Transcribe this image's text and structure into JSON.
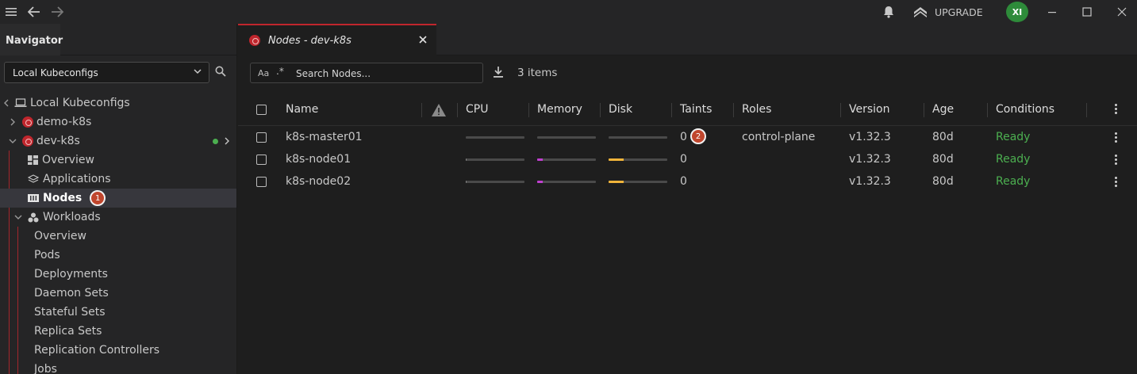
{
  "titlebar": {
    "upgrade_label": "UPGRADE",
    "avatar_initials": "XI"
  },
  "navigator": {
    "tab_label": "Navigator",
    "context_select_value": "Local Kubeconfigs",
    "tree": {
      "root_label": "Local Kubeconfigs",
      "clusters": [
        {
          "label": "demo-k8s"
        },
        {
          "label": "dev-k8s"
        }
      ],
      "dev_items": {
        "overview": "Overview",
        "applications": "Applications",
        "nodes": "Nodes",
        "nodes_badge": "1",
        "workloads": "Workloads"
      },
      "workload_items": [
        "Overview",
        "Pods",
        "Deployments",
        "Daemon Sets",
        "Stateful Sets",
        "Replica Sets",
        "Replication Controllers",
        "Jobs"
      ]
    }
  },
  "main": {
    "tab_title": "Nodes - dev-k8s",
    "search": {
      "aa_label": "Aa",
      "regex_label": ".*",
      "placeholder": "Search Nodes..."
    },
    "items_count": "3 items",
    "taints_badge": "2",
    "columns": {
      "name": "Name",
      "cpu": "CPU",
      "memory": "Memory",
      "disk": "Disk",
      "taints": "Taints",
      "roles": "Roles",
      "version": "Version",
      "age": "Age",
      "conditions": "Conditions"
    },
    "rows": [
      {
        "name": "k8s-master01",
        "cpu": 0.0,
        "memory": 0.0,
        "disk": 0.0,
        "taints": "0",
        "roles": "control-plane",
        "version": "v1.32.3",
        "age": "80d",
        "conditions": "Ready"
      },
      {
        "name": "k8s-node01",
        "cpu": 0.02,
        "memory": 0.1,
        "disk": 0.25,
        "taints": "0",
        "roles": "",
        "version": "v1.32.3",
        "age": "80d",
        "conditions": "Ready"
      },
      {
        "name": "k8s-node02",
        "cpu": 0.02,
        "memory": 0.1,
        "disk": 0.25,
        "taints": "0",
        "roles": "",
        "version": "v1.32.3",
        "age": "80d",
        "conditions": "Ready"
      }
    ]
  },
  "colors": {
    "accent": "#c0262d",
    "ready": "#4caf50",
    "memory_bar": "#c03fd0",
    "disk_bar": "#f0b43a",
    "cpu_bar": "#8a8a8a"
  },
  "icons": [
    "menu-icon",
    "back-arrow-icon",
    "forward-arrow-icon",
    "bell-icon",
    "upgrade-icon",
    "minimize-icon",
    "maximize-icon",
    "close-icon",
    "search-icon",
    "download-icon",
    "warning-icon",
    "kebab-icon"
  ]
}
